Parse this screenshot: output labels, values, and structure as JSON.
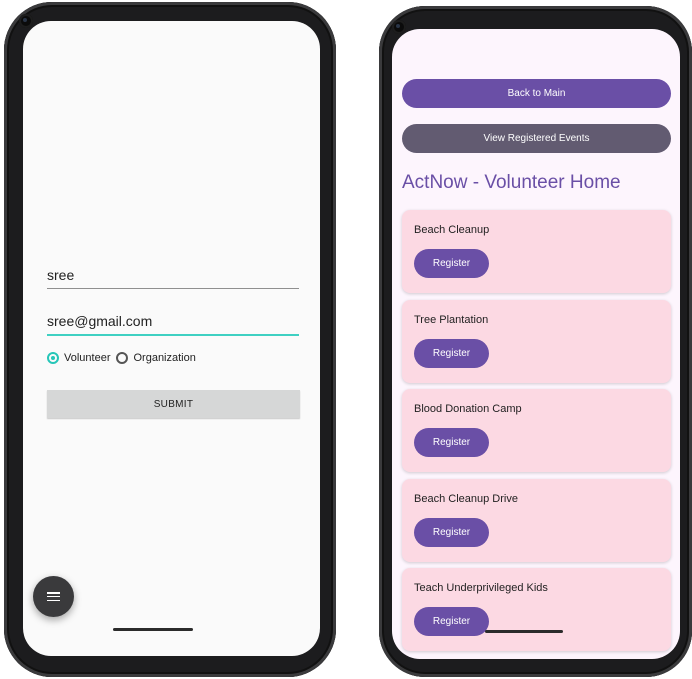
{
  "left_screen": {
    "name_value": "sree",
    "email_value": "sree@gmail.com",
    "role_options": [
      {
        "label": "Volunteer",
        "checked": true
      },
      {
        "label": "Organization",
        "checked": false
      }
    ],
    "submit_label": "SUBMIT",
    "fab_icon": "menu-icon"
  },
  "right_screen": {
    "back_label": "Back to Main",
    "view_registered_label": "View Registered Events",
    "title": "ActNow - Volunteer Home",
    "events": [
      {
        "title": "Beach Cleanup",
        "button": "Register"
      },
      {
        "title": "Tree Plantation",
        "button": "Register"
      },
      {
        "title": "Blood Donation Camp",
        "button": "Register"
      },
      {
        "title": "Beach Cleanup Drive",
        "button": "Register"
      },
      {
        "title": "Teach Underprivileged Kids",
        "button": "Register"
      }
    ]
  },
  "colors": {
    "primary_purple": "#6a4fa6",
    "secondary_gray_purple": "#625b71",
    "card_pink": "#fcd9e3",
    "accent_teal": "#26c6b8"
  }
}
